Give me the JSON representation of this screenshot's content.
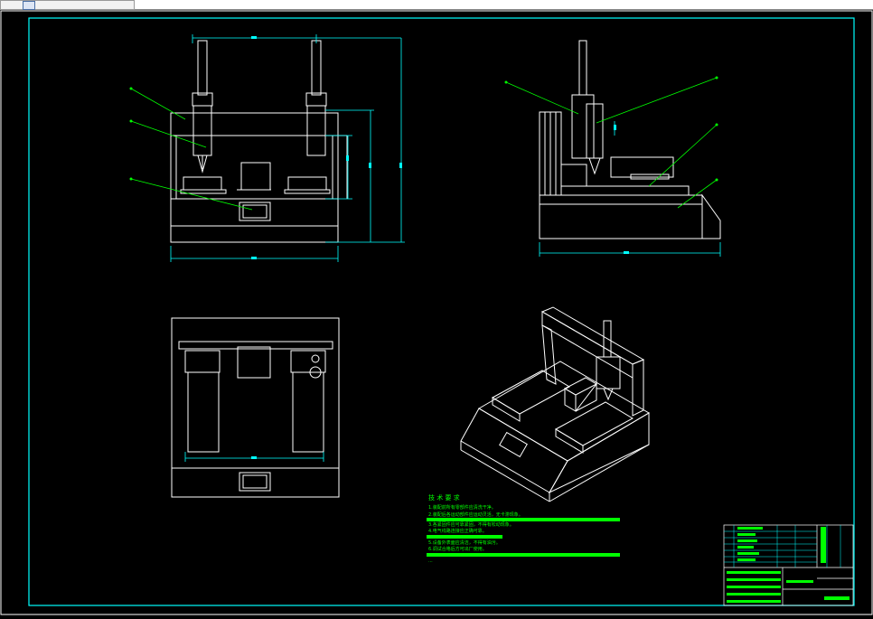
{
  "window": {
    "tab_label": ""
  },
  "notes": {
    "title": "技 术 要 求",
    "lines": [
      "1.装配前所有零部件应清洗干净。",
      "2.装配后各运动部件应运动灵活，无卡滞现象。",
      "3.各紧固件应可靠紧固，不得有松动现象。",
      "4.电气线路连接应正确可靠。",
      "5.设备外表面应清洁，不得有油污。",
      "6.调试合格后方可出厂使用。"
    ]
  },
  "colors": {
    "line": "#ffffff",
    "dim": "#00ffff",
    "leader": "#00ff00",
    "border": "#00ffff"
  }
}
